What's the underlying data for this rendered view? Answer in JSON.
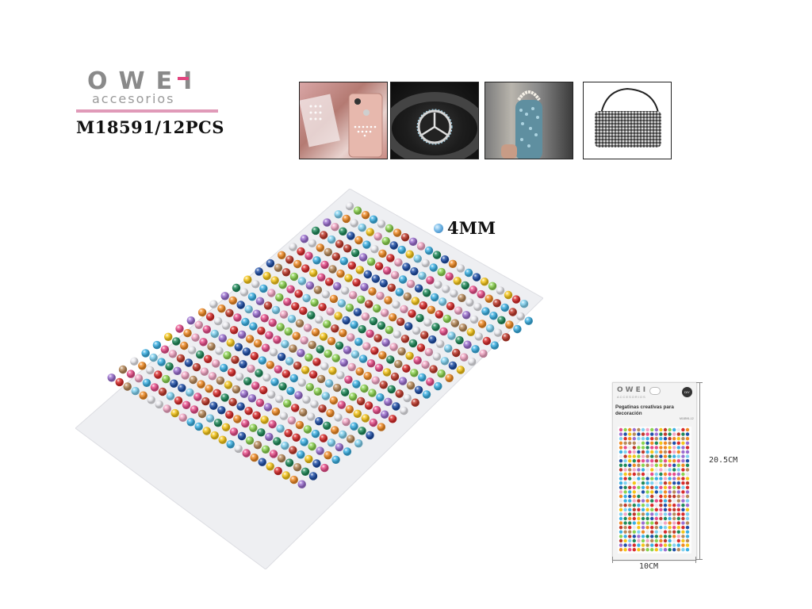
{
  "brand": {
    "name": "OWEI",
    "sub": "accesorios"
  },
  "product": {
    "model": "M18591/12PCS",
    "gem_size": "4MM"
  },
  "thumbnails": [
    {
      "icon": "phone-with-stickers"
    },
    {
      "icon": "steering-wheel-emblem"
    },
    {
      "icon": "rhinestone-bottle"
    },
    {
      "icon": "rhinestone-handbag"
    }
  ],
  "package": {
    "logo": "OWEI",
    "logo_sub": "ACCESORIOS",
    "badge": "DIY",
    "title": "Pegatinas creativas para decoración",
    "code": "M18591-12",
    "width": "10CM",
    "height": "20.5CM"
  },
  "colors": {
    "brand_pink": "#e3447f",
    "brand_grey": "#8a8a8a",
    "gems": [
      "#d92b2b",
      "#f08a24",
      "#f5c518",
      "#3bb0e3",
      "#e84d8a",
      "#f2a6c4",
      "#e9e9ee",
      "#8bd34f",
      "#9b6fd0",
      "#1f4fa8",
      "#1f8a5a",
      "#b88a5a",
      "#c0392b",
      "#7fd1f0"
    ]
  }
}
